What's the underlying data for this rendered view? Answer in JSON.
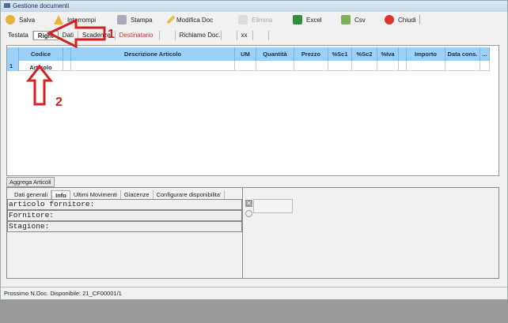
{
  "window": {
    "title": "Gestione documenti"
  },
  "toolbar": {
    "salva": "Salva",
    "interrompi": "Interrompi",
    "stampa": "Stampa",
    "modifica": "Modifica Doc",
    "elimina": "Elimina",
    "excel": "Excel",
    "csv": "Csv",
    "chiudi": "Chiudi"
  },
  "tabs": [
    "Testata",
    "Righi",
    "Dati",
    "Scadenze",
    "Destinatario",
    "",
    "Richiamo Doc.",
    "",
    "xx",
    ""
  ],
  "grid": {
    "columns": [
      "Codice Articolo",
      "",
      "Descrizione Articolo",
      "UM",
      "Quantità",
      "Prezzo",
      "%Sc1",
      "%Sc2",
      "%Iva",
      "",
      "Importo",
      "Data cons.",
      "..."
    ],
    "rows": [
      "1"
    ]
  },
  "aggrega": "Aggrega Articoli",
  "lower_tabs": [
    "Dati generali",
    "Info",
    "Ultimi Movimenti",
    "Giacenze",
    "Configurare disponibilita'"
  ],
  "info": {
    "articolo": "articolo fornitore:",
    "fornitore": "Fornitore:",
    "stagione": "Stagione:"
  },
  "status": "Prossimo N.Doc. Disponibile: 21_CF00001/1",
  "annotations": {
    "arrow1": "1",
    "arrow2": "2"
  },
  "colors": {
    "header": "#9dd0f6",
    "annotation": "#d42020",
    "destinatario": "#c0392b"
  }
}
